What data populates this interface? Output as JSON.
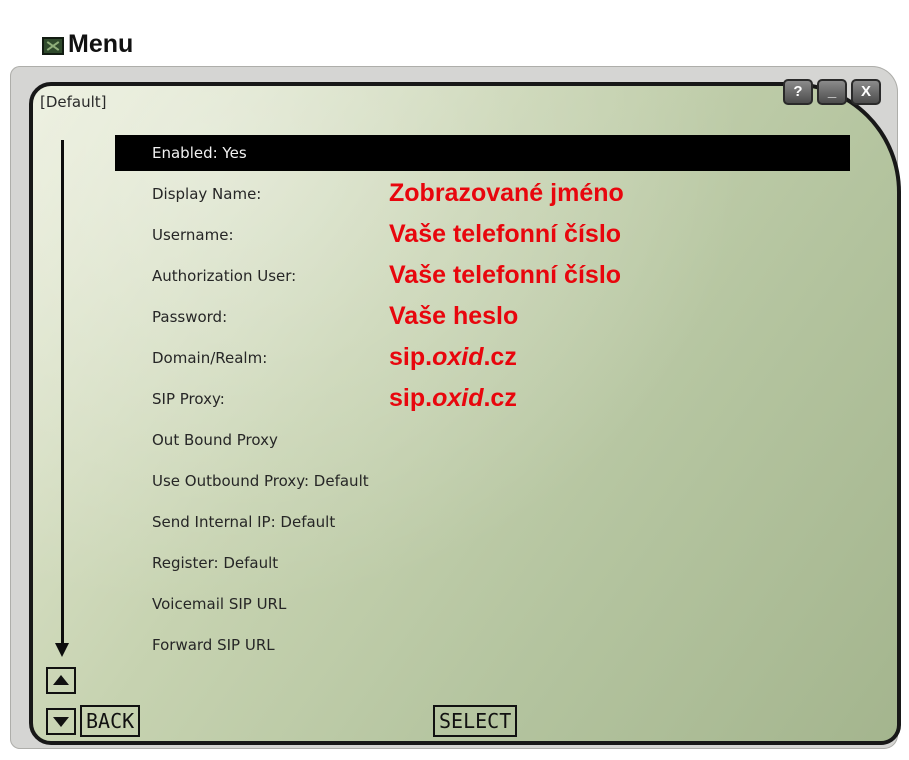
{
  "window": {
    "title": "Menu",
    "profile": "[Default]",
    "controls": {
      "help": "?",
      "minimize": "_",
      "close": "X"
    }
  },
  "menu": {
    "items": [
      {
        "label": "Enabled: Yes",
        "selected": true
      },
      {
        "label": "Display Name:",
        "annotation": "Zobrazované jméno"
      },
      {
        "label": "Username:",
        "annotation": "Vaše telefonní číslo"
      },
      {
        "label": "Authorization User:",
        "annotation": "Vaše telefonní číslo"
      },
      {
        "label": "Password:",
        "annotation": "Vaše heslo"
      },
      {
        "label": "Domain/Realm:",
        "annotation_pre": "sip.",
        "annotation_em": "oxid",
        "annotation_post": ".cz"
      },
      {
        "label": "SIP Proxy:",
        "annotation_pre": "sip.",
        "annotation_em": "oxid",
        "annotation_post": ".cz"
      },
      {
        "label": "Out Bound Proxy"
      },
      {
        "label": "Use Outbound Proxy: Default"
      },
      {
        "label": "Send Internal IP: Default"
      },
      {
        "label": "Register: Default"
      },
      {
        "label": "Voicemail SIP URL"
      },
      {
        "label": "Forward SIP URL"
      }
    ]
  },
  "softkeys": {
    "back": "BACK",
    "select": "SELECT"
  },
  "icons": {
    "app": "app-menu-icon",
    "scroll_up": "triangle-up-icon",
    "scroll_down": "triangle-down-icon",
    "scroll_indicator": "down-arrow-icon"
  },
  "colors": {
    "annotation": "#e8060d",
    "screen": "#c7d3b1",
    "selected_row": "#000000"
  }
}
